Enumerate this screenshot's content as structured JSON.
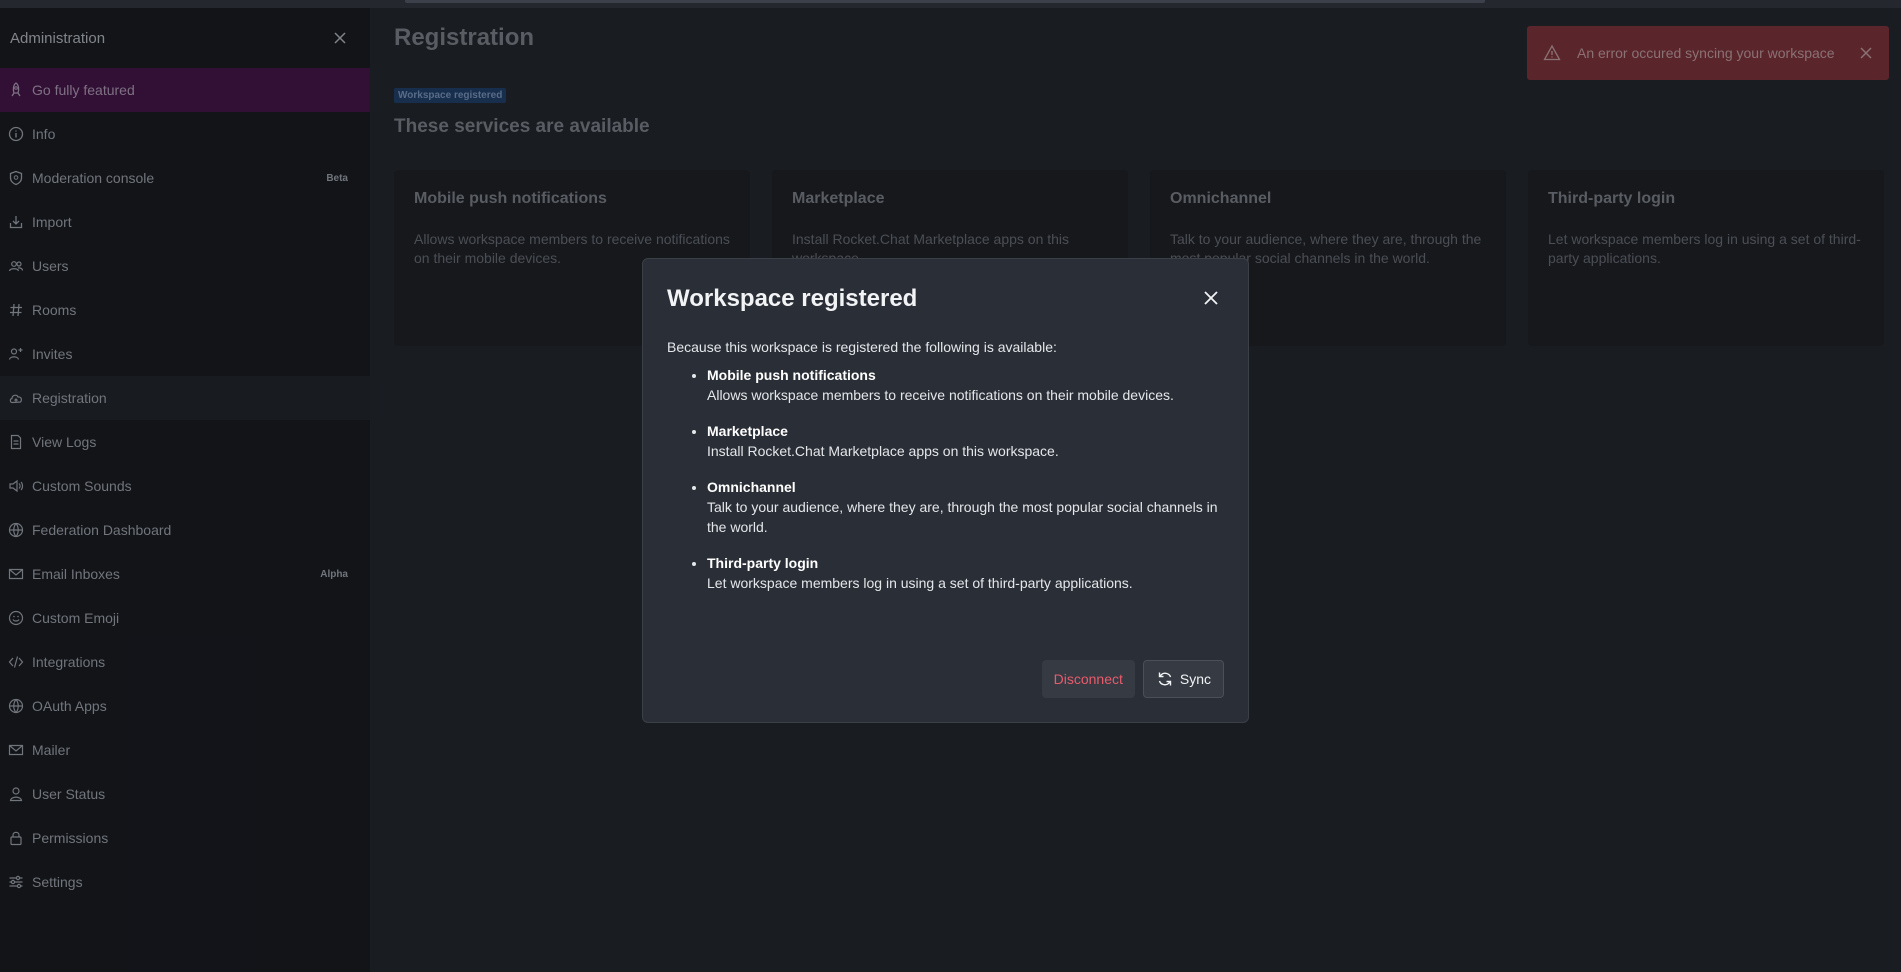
{
  "sidebar": {
    "title": "Administration",
    "items": [
      {
        "label": "Go fully featured",
        "icon": "rocket-icon",
        "badge": ""
      },
      {
        "label": "Info",
        "icon": "info-icon",
        "badge": ""
      },
      {
        "label": "Moderation console",
        "icon": "shield-icon",
        "badge": "Beta"
      },
      {
        "label": "Import",
        "icon": "import-icon",
        "badge": ""
      },
      {
        "label": "Users",
        "icon": "users-icon",
        "badge": ""
      },
      {
        "label": "Rooms",
        "icon": "hashtag-icon",
        "badge": ""
      },
      {
        "label": "Invites",
        "icon": "user-plus-icon",
        "badge": ""
      },
      {
        "label": "Registration",
        "icon": "cloud-icon",
        "badge": ""
      },
      {
        "label": "View Logs",
        "icon": "document-icon",
        "badge": ""
      },
      {
        "label": "Custom Sounds",
        "icon": "speaker-icon",
        "badge": ""
      },
      {
        "label": "Federation Dashboard",
        "icon": "globe-icon",
        "badge": ""
      },
      {
        "label": "Email Inboxes",
        "icon": "mail-icon",
        "badge": "Alpha"
      },
      {
        "label": "Custom Emoji",
        "icon": "emoji-icon",
        "badge": ""
      },
      {
        "label": "Integrations",
        "icon": "code-icon",
        "badge": ""
      },
      {
        "label": "OAuth Apps",
        "icon": "globe-icon",
        "badge": ""
      },
      {
        "label": "Mailer",
        "icon": "mail-icon",
        "badge": ""
      },
      {
        "label": "User Status",
        "icon": "user-icon",
        "badge": ""
      },
      {
        "label": "Permissions",
        "icon": "lock-icon",
        "badge": ""
      },
      {
        "label": "Settings",
        "icon": "sliders-icon",
        "badge": ""
      }
    ]
  },
  "main": {
    "title": "Registration",
    "tag": "Workspace registered",
    "section_title": "These services are available",
    "cards": [
      {
        "title": "Mobile push notifications",
        "desc": "Allows workspace members to receive notifications on their mobile devices."
      },
      {
        "title": "Marketplace",
        "desc": "Install Rocket.Chat Marketplace apps on this workspace."
      },
      {
        "title": "Omnichannel",
        "desc": "Talk to your audience, where they are, through the most popular social channels in the world."
      },
      {
        "title": "Third-party login",
        "desc": "Let workspace members log in using a set of third-party applications."
      }
    ]
  },
  "toast": {
    "message": "An error occured syncing your workspace"
  },
  "modal": {
    "title": "Workspace registered",
    "intro": "Because this workspace is registered the following is available:",
    "features": [
      {
        "title": "Mobile push notifications",
        "desc": "Allows workspace members to receive notifications on their mobile devices."
      },
      {
        "title": "Marketplace",
        "desc": "Install Rocket.Chat Marketplace apps on this workspace."
      },
      {
        "title": "Omnichannel",
        "desc": "Talk to your audience, where they are, through the most popular social channels in the world."
      },
      {
        "title": "Third-party login",
        "desc": "Let workspace members log in using a set of third-party applications."
      }
    ],
    "disconnect_label": "Disconnect",
    "sync_label": "Sync"
  },
  "colors": {
    "featured_bg": "#3d1442",
    "danger": "#e95b6b",
    "toast_bg": "#6e2f36",
    "tag_bg": "#1d3a5e"
  }
}
